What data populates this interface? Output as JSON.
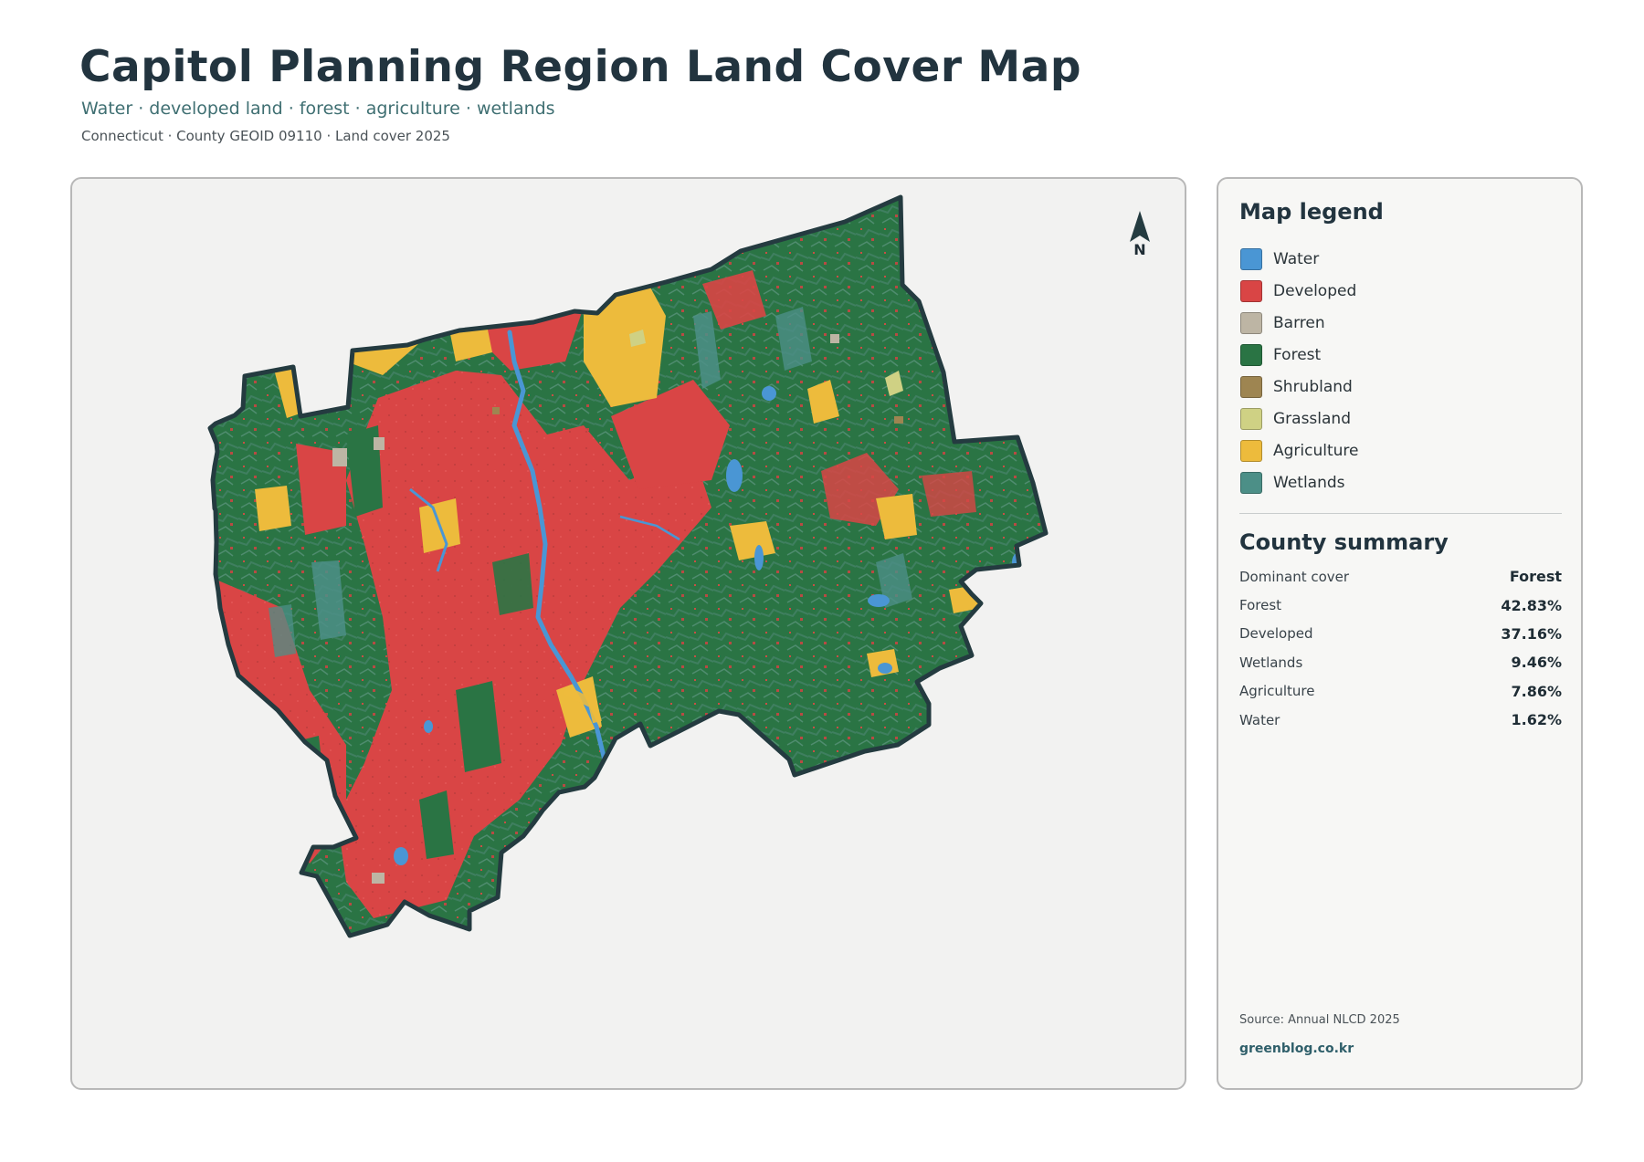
{
  "header": {
    "title": "Capitol Planning Region Land Cover Map",
    "subtitle": "Water · developed land · forest · agriculture · wetlands",
    "meta": "Connecticut · County GEOID 09110 · Land cover 2025"
  },
  "map": {
    "north_label": "N",
    "north_icon": "north-arrow-icon",
    "outline_color": "#243b40",
    "background_color": "#f2f2f1"
  },
  "legend": {
    "heading": "Map legend",
    "items": [
      {
        "label": "Water",
        "color": "#4a96d4"
      },
      {
        "label": "Developed",
        "color": "#d94545"
      },
      {
        "label": "Barren",
        "color": "#bdb5a4"
      },
      {
        "label": "Forest",
        "color": "#2a7444"
      },
      {
        "label": "Shrubland",
        "color": "#9e8551"
      },
      {
        "label": "Grassland",
        "color": "#cfd184"
      },
      {
        "label": "Agriculture",
        "color": "#edbb3c"
      },
      {
        "label": "Wetlands",
        "color": "#4c8f87"
      }
    ]
  },
  "summary": {
    "heading": "County summary",
    "rows": [
      {
        "label": "Dominant cover",
        "value": "Forest"
      },
      {
        "label": "Forest",
        "value": "42.83%"
      },
      {
        "label": "Developed",
        "value": "37.16%"
      },
      {
        "label": "Wetlands",
        "value": "9.46%"
      },
      {
        "label": "Agriculture",
        "value": "7.86%"
      },
      {
        "label": "Water",
        "value": "1.62%"
      }
    ]
  },
  "footer": {
    "source": "Source: Annual NLCD 2025",
    "credit": "greenblog.co.kr"
  }
}
